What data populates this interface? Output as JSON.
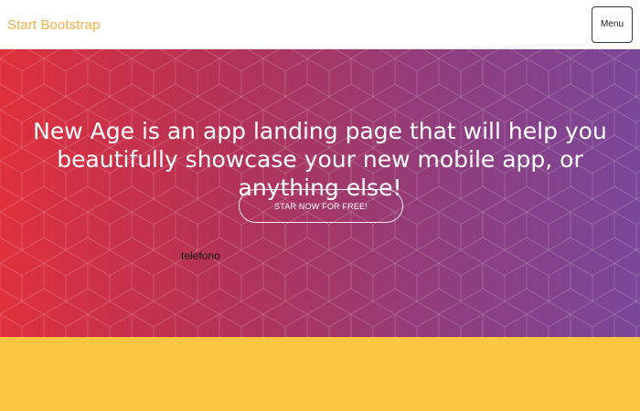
{
  "navbar": {
    "brand": "Start Bootstrap",
    "menu_label": "Menu"
  },
  "masthead": {
    "headline": "New Age is an app landing page that will help you beautifully showcase your new mobile app, or anything else!",
    "cta_label": "STAR NOW FOR FREE!",
    "device_label": "telefono"
  },
  "colors": {
    "brand": "#f8b34b",
    "gradient_start": "#e0303c",
    "gradient_end": "#7a4799",
    "section_yellow": "#fbc641"
  }
}
